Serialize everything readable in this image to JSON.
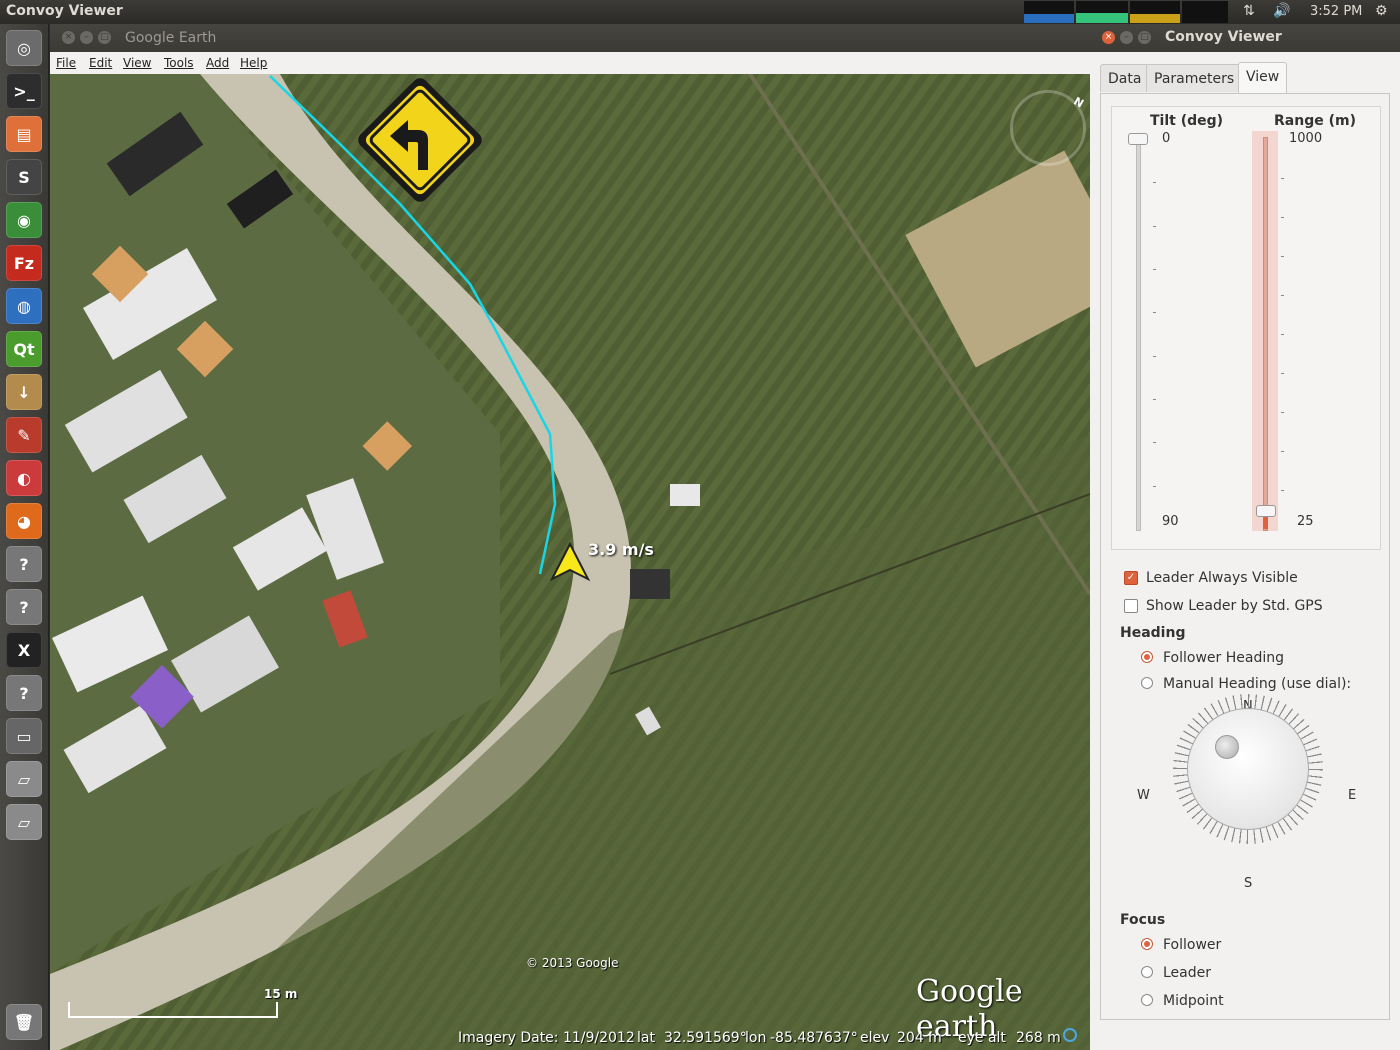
{
  "top_panel": {
    "title": "Convoy Viewer",
    "time": "3:52 PM"
  },
  "launcher": {
    "items": [
      {
        "name": "dash-icon",
        "color": "#6b6b6b",
        "glyph": "◎"
      },
      {
        "name": "terminal-icon",
        "color": "#2d2d2d",
        "glyph": ">_"
      },
      {
        "name": "files-icon",
        "color": "#e0703a",
        "glyph": "▤"
      },
      {
        "name": "sublime-icon",
        "color": "#444",
        "glyph": "S"
      },
      {
        "name": "chrome-icon",
        "color": "#3a8e3a",
        "glyph": "◉"
      },
      {
        "name": "filezilla-icon",
        "color": "#c42a1e",
        "glyph": "Fz"
      },
      {
        "name": "google-earth-icon",
        "color": "#2f6fbf",
        "glyph": "◍"
      },
      {
        "name": "qt-icon",
        "color": "#4a9c2d",
        "glyph": "Qt"
      },
      {
        "name": "installer-icon",
        "color": "#b38b4c",
        "glyph": "↓"
      },
      {
        "name": "settings-icon",
        "color": "#b83b2b",
        "glyph": "✎"
      },
      {
        "name": "app-icon",
        "color": "#cc3b3b",
        "glyph": "◐"
      },
      {
        "name": "firefox-icon",
        "color": "#e06a1c",
        "glyph": "◕"
      },
      {
        "name": "unknown-app-icon",
        "color": "#777",
        "glyph": "?"
      },
      {
        "name": "unknown-app-icon",
        "color": "#777",
        "glyph": "?"
      },
      {
        "name": "xterm-icon",
        "color": "#222",
        "glyph": "X"
      },
      {
        "name": "unknown-app-icon",
        "color": "#777",
        "glyph": "?"
      },
      {
        "name": "window-icon",
        "color": "#666",
        "glyph": "▭"
      },
      {
        "name": "drive-icon",
        "color": "#8a8a8a",
        "glyph": "▱"
      },
      {
        "name": "drive-icon",
        "color": "#8a8a8a",
        "glyph": "▱"
      },
      {
        "name": "trash-icon",
        "color": "#777",
        "glyph": "🗑"
      }
    ]
  },
  "google_earth": {
    "window_title": "Google Earth",
    "menu": [
      "File",
      "Edit",
      "View",
      "Tools",
      "Add",
      "Help"
    ],
    "speed": "3.9 m/s",
    "copyright": "© 2013 Google",
    "scale": "15 m",
    "logo": "Google earth",
    "status": {
      "imagery_date": "Imagery Date: 11/9/2012",
      "lat_label": "lat",
      "lat": "32.591569°",
      "lon_label": "lon",
      "lon": "-85.487637°",
      "elev_label": "elev",
      "elev": "204 m",
      "eye_alt_label": "eye alt",
      "eye_alt": "268 m"
    },
    "compass_n": "N",
    "path_color": "#19d6e6",
    "sign_color": "#f2d41a"
  },
  "convoy_viewer": {
    "window_title": "Convoy Viewer",
    "tabs": [
      "Data",
      "Parameters",
      "View"
    ],
    "active_tab": "View",
    "tilt": {
      "label": "Tilt (deg)",
      "min": "0",
      "max": "90",
      "value": 0
    },
    "range": {
      "label": "Range (m)",
      "max": "1000",
      "min": "25",
      "value": 25
    },
    "leader_always_visible": {
      "label": "Leader Always Visible",
      "checked": true
    },
    "show_leader_std_gps": {
      "label": "Show Leader by Std. GPS",
      "checked": false
    },
    "heading": {
      "label": "Heading",
      "options": [
        "Follower Heading",
        "Manual Heading (use dial):"
      ],
      "selected": 0
    },
    "dial": {
      "n": "N",
      "e": "E",
      "s": "S",
      "w": "W"
    },
    "focus": {
      "label": "Focus",
      "options": [
        "Follower",
        "Leader",
        "Midpoint"
      ],
      "selected": 0
    },
    "accent_color": "#e0623c"
  }
}
